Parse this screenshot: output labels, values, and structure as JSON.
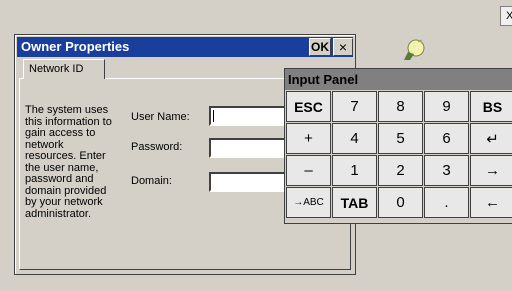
{
  "screen": {
    "close_label": "X"
  },
  "dialog": {
    "title": "Owner Properties",
    "ok_label": "OK",
    "close_label": "×",
    "tab_label": "Network ID",
    "description_lines": [
      "The system uses",
      "this information to",
      "gain access to",
      "network",
      "resources. Enter",
      "the user name,",
      "password and",
      "domain provided",
      "by your network",
      "administrator."
    ],
    "fields": {
      "username": {
        "label": "User Name:",
        "value": ""
      },
      "password": {
        "label": "Password:",
        "value": ""
      },
      "domain": {
        "label": "Domain:",
        "value": ""
      }
    }
  },
  "input_panel": {
    "title": "Input Panel",
    "keys": [
      [
        "ESC",
        "7",
        "8",
        "9",
        "BS"
      ],
      [
        "+",
        "4",
        "5",
        "6",
        "↵"
      ],
      [
        "–",
        "1",
        "2",
        "3",
        "→"
      ],
      [
        "→ABC",
        "TAB",
        "0",
        ".",
        "←"
      ]
    ]
  },
  "colors": {
    "title_bar": "#1a3e9c",
    "input_panel_title": "#808080",
    "desktop": "#d4d0c8"
  }
}
